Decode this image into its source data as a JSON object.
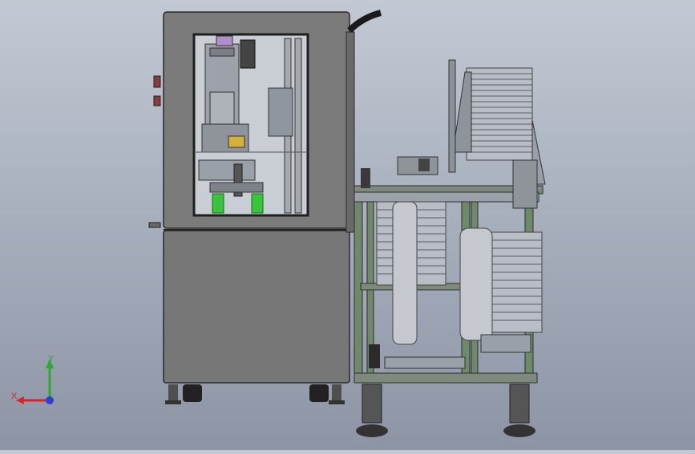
{
  "viewport": {
    "view": "front",
    "colors": {
      "background_top": "#c3c9d3",
      "background_bottom": "#8d95a5",
      "cabinet": "#7a7a7a",
      "frame": "#6f8a6a",
      "accent_green": "#39c43c",
      "accent_red": "#c0392b",
      "tray_stack": "#b8bdc6"
    }
  },
  "triad": {
    "x_label": "X",
    "y_label": "Y",
    "x_color": "#d62828",
    "y_color": "#2eaa2e",
    "z_color": "#2a3fd6"
  },
  "parts": [
    "cabinet",
    "viewing-window",
    "tray-stack-upper",
    "tray-stack-lower",
    "aluminum-frame",
    "cable-chain",
    "leveling-feet",
    "casters"
  ]
}
